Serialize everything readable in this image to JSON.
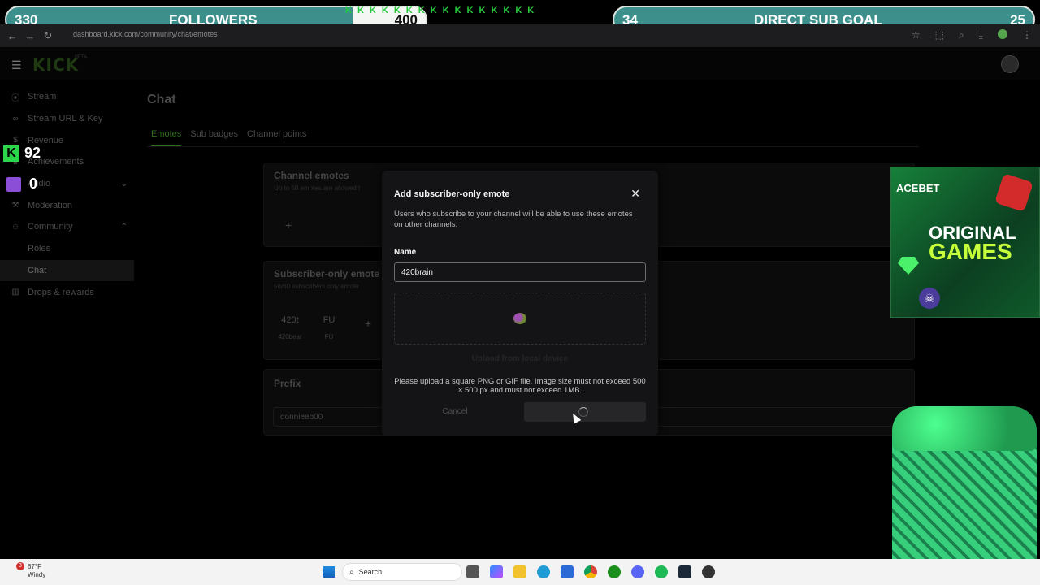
{
  "browser": {
    "url": "dashboard.kick.com/community/chat/emotes"
  },
  "header": {
    "logo": "KICK",
    "beta": "BETA"
  },
  "sidebar": {
    "items": [
      {
        "label": "Stream",
        "icon": "broadcast-icon"
      },
      {
        "label": "Stream URL & Key",
        "icon": "link-icon"
      },
      {
        "label": "Revenue",
        "icon": "dollar-icon"
      },
      {
        "label": "Achievements",
        "icon": "trophy-icon"
      },
      {
        "label": "Audio",
        "icon": "audio-icon"
      },
      {
        "label": "Moderation",
        "icon": "wrench-icon"
      },
      {
        "label": "Community",
        "icon": "users-icon"
      },
      {
        "label": "Roles"
      },
      {
        "label": "Chat"
      },
      {
        "label": "Drops & rewards",
        "icon": "gift-icon"
      }
    ]
  },
  "page": {
    "title": "Chat",
    "tabs": [
      "Emotes",
      "Sub badges",
      "Channel points"
    ]
  },
  "channel_emotes": {
    "title": "Channel emotes",
    "subtitle": "Up to 60 emotes are allowed t",
    "add": "+"
  },
  "subscriber_emotes": {
    "title": "Subscriber-only emote",
    "subtitle": "58/60 subscribers only emote",
    "emotes": [
      {
        "img": "420t",
        "label": "420bear"
      },
      {
        "img": "FU",
        "label": "FU"
      }
    ],
    "add": "+"
  },
  "prefix": {
    "title": "Prefix",
    "value": "donnieeb00"
  },
  "modal": {
    "title": "Add subscriber-only emote",
    "close": "✕",
    "description": "Users who subscribe to your channel will be able to use these emotes on other channels.",
    "name_label": "Name",
    "name_value": "420brain",
    "upload_label": "Upload from local device",
    "help_text": "Please upload a square PNG or GIF file. Image size must not exceed 500 × 500 px and must not exceed 1MB.",
    "cancel_label": "Cancel"
  },
  "overlays": {
    "followers_goal": {
      "current": "330",
      "label": "FOLLOWERS",
      "target": "400",
      "progress": 0.825
    },
    "sub_goal": {
      "current": "34",
      "label": "DIRECT SUB GOAL",
      "target": "25",
      "progress": 1.0
    },
    "k_strip": [
      "K",
      "K",
      "K",
      "K",
      "K",
      "K",
      "K",
      "K",
      "K",
      "K",
      "K",
      "K",
      "K",
      "K",
      "K",
      "K"
    ],
    "kick_count": "92",
    "twitch_count": "0",
    "ad": {
      "brand": "ACEBET",
      "line1": "ORIGINAL",
      "line2": "GAMES"
    }
  },
  "taskbar": {
    "weather_temp": "67°F",
    "weather_desc": "Windy",
    "weather_badge": "3",
    "search_placeholder": "Search"
  },
  "colors": {
    "kick_green": "#53fc18",
    "goal_fill": "#3d8f8c",
    "modal_bg": "#141416"
  }
}
